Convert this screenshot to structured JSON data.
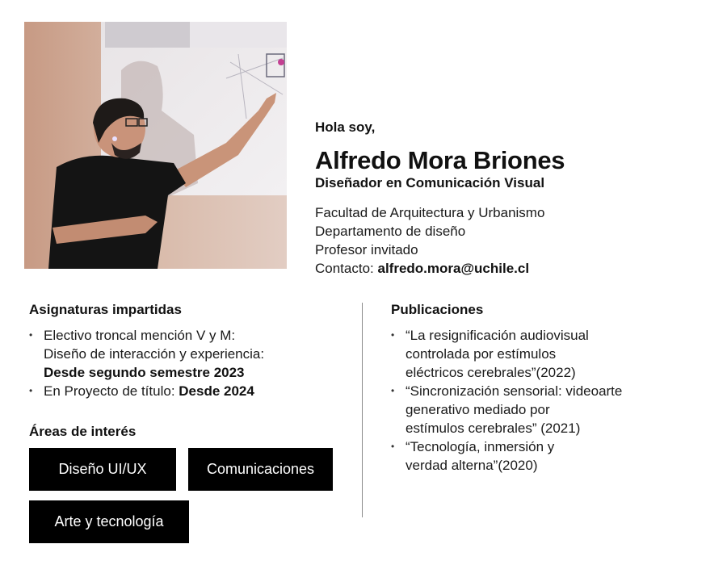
{
  "profile": {
    "greeting": "Hola soy,",
    "name": "Alfredo Mora Briones",
    "role": "Diseñador en Comunicación Visual",
    "faculty": "Facultad de Arquitectura y Urbanismo",
    "department": "Departamento de diseño",
    "position": "Profesor invitado",
    "contact_label": "Contacto: ",
    "contact_email": "alfredo.mora@uchile.cl"
  },
  "courses": {
    "title": "Asignaturas impartidas",
    "item1_line1": "Electivo troncal mención V y M:",
    "item1_line2": "Diseño de interacción y experiencia:",
    "item1_line3": "Desde segundo semestre 2023",
    "item2_prefix": "En Proyecto de título: ",
    "item2_bold": "Desde 2024"
  },
  "interests": {
    "title": "Áreas de interés",
    "tags": [
      "Diseño UI/UX",
      "Comunicaciones",
      "Arte y tecnología"
    ]
  },
  "publications": {
    "title": "Publicaciones",
    "items": [
      {
        "lines": [
          "“La resignificación audiovisual",
          "controlada por estímulos",
          "eléctricos cerebrales”(2022)"
        ]
      },
      {
        "lines": [
          "“Sincronización sensorial: videoarte",
          "generativo mediado por",
          "estímulos cerebrales” (2021)"
        ]
      },
      {
        "lines": [
          "“Tecnología, inmersión y",
          "verdad alterna”(2020)"
        ]
      }
    ]
  },
  "colors": {
    "text": "#111111",
    "tag_background": "#000000",
    "tag_text": "#ffffff",
    "divider": "#8a8a8a"
  }
}
